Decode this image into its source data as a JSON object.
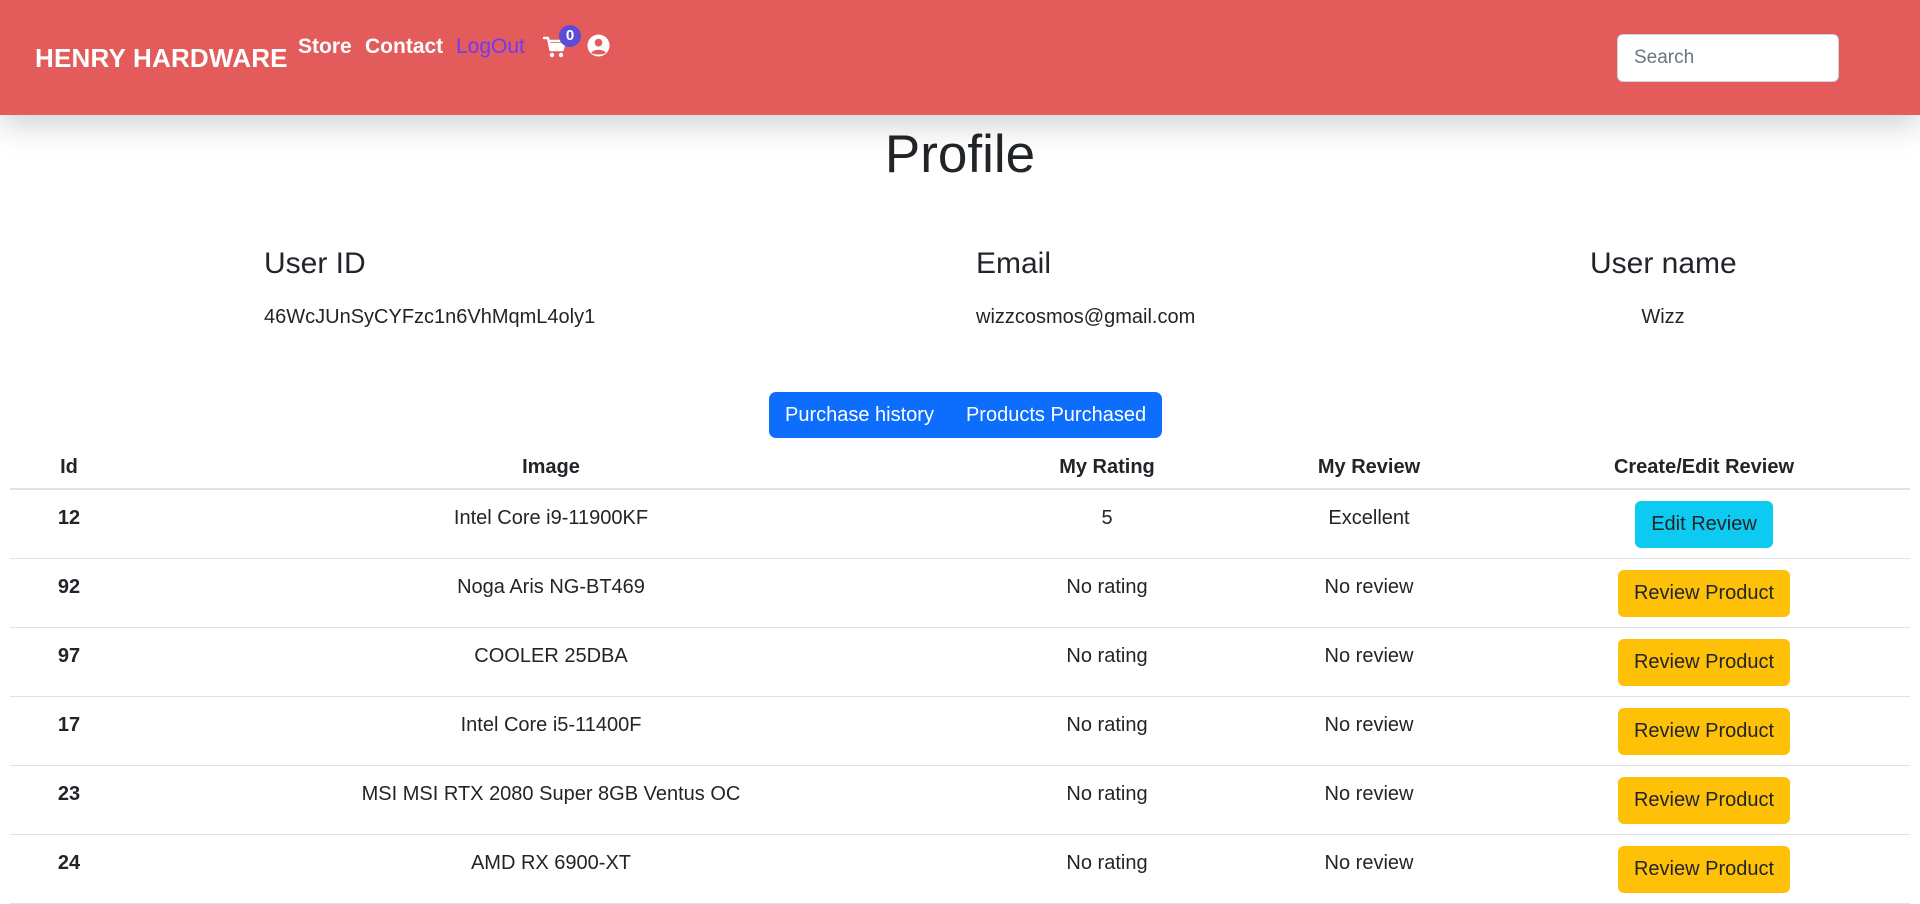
{
  "navbar": {
    "brand": "HENRY HARDWARE",
    "links": [
      "Store",
      "Contact",
      "LogOut"
    ],
    "cart_count": "0",
    "cart_icon": "cart-icon",
    "user_icon": "user-circle-icon",
    "search_placeholder": "Search",
    "search_value": "",
    "colors": {
      "background": "#e35b5b",
      "logout_link": "#6c3bf5",
      "badge": "#5b4bd6"
    }
  },
  "profile": {
    "title": "Profile",
    "user_id_label": "User ID",
    "user_id": "46WcJUnSyCYFzc1n6VhMqmL4oly1",
    "email_label": "Email",
    "email": "wizzcosmos@gmail.com",
    "username_label": "User name",
    "username": "Wizz"
  },
  "tabs": [
    "Purchase history",
    "Products Purchased"
  ],
  "table": {
    "headers": [
      "Id",
      "Image",
      "My Rating",
      "My Review",
      "Create/Edit Review"
    ],
    "rows": [
      {
        "id": "12",
        "image": "Intel Core i9-11900KF",
        "rating": "5",
        "review": "Excellent",
        "action": "Edit Review",
        "action_type": "edit"
      },
      {
        "id": "92",
        "image": "Noga Aris NG-BT469",
        "rating": "No rating",
        "review": "No review",
        "action": "Review Product",
        "action_type": "review"
      },
      {
        "id": "97",
        "image": "COOLER 25DBA",
        "rating": "No rating",
        "review": "No review",
        "action": "Review Product",
        "action_type": "review"
      },
      {
        "id": "17",
        "image": "Intel Core i5-11400F",
        "rating": "No rating",
        "review": "No review",
        "action": "Review Product",
        "action_type": "review"
      },
      {
        "id": "23",
        "image": "MSI MSI RTX 2080 Super 8GB Ventus OC",
        "rating": "No rating",
        "review": "No review",
        "action": "Review Product",
        "action_type": "review"
      },
      {
        "id": "24",
        "image": "AMD RX 6900-XT",
        "rating": "No rating",
        "review": "No review",
        "action": "Review Product",
        "action_type": "review"
      }
    ],
    "colors": {
      "edit_button": "#0dcaf0",
      "review_button": "#ffc107",
      "tab_button": "#0d6efd"
    }
  }
}
